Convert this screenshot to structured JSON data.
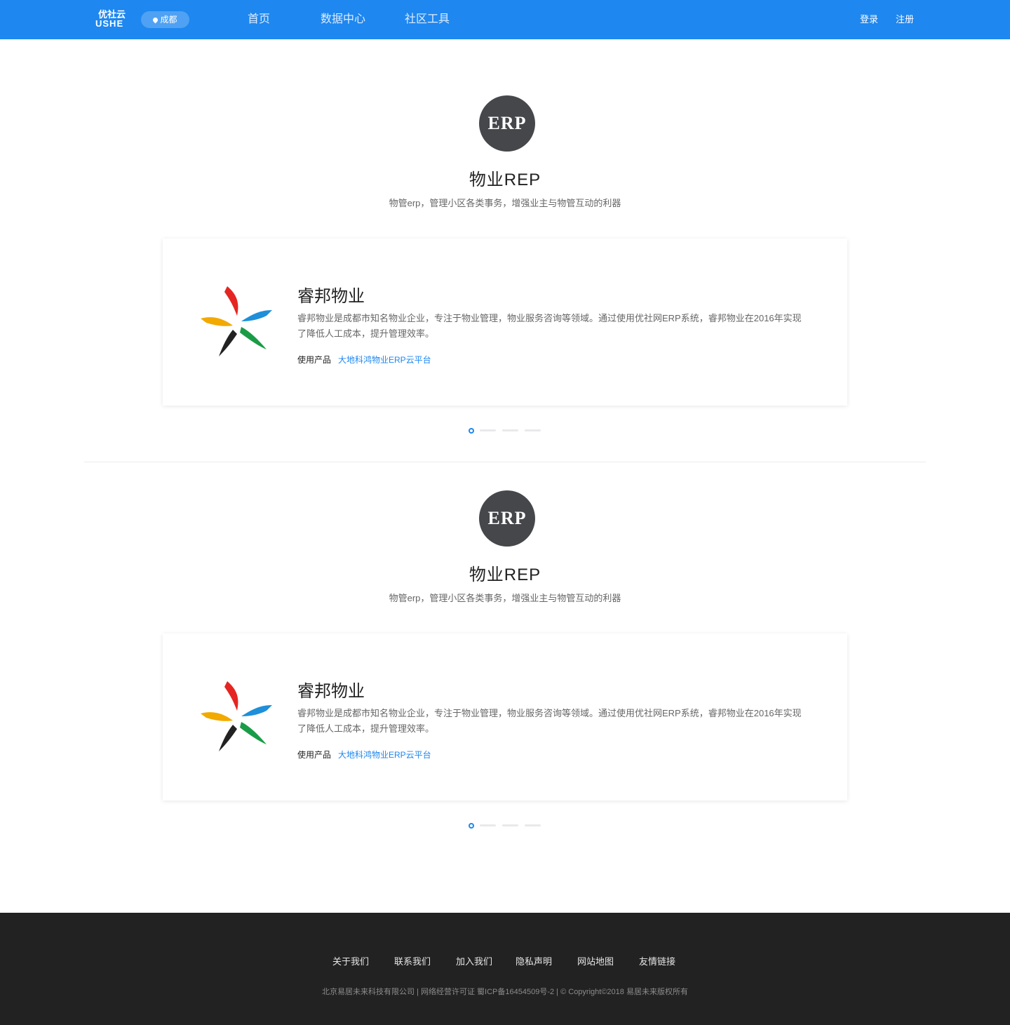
{
  "header": {
    "logo_cn": "优社云",
    "logo_en": "USHE",
    "city": "成都",
    "nav": [
      "首页",
      "数据中心",
      "社区工具"
    ],
    "login": "登录",
    "register": "注册"
  },
  "sections": [
    {
      "badge": "ERP",
      "title": "物业REP",
      "subtitle": "物管erp，管理小区各类事务，增强业主与物管互动的利器",
      "card": {
        "name": "睿邦物业",
        "desc": "睿邦物业是成都市知名物业企业，专注于物业管理，物业服务咨询等领域。通过使用优社网ERP系统，睿邦物业在2016年实现了降低人工成本，提升管理效率。",
        "product_label": "使用产品",
        "product_link": "大地科鸿物业ERP云平台"
      }
    },
    {
      "badge": "ERP",
      "title": "物业REP",
      "subtitle": "物管erp，管理小区各类事务，增强业主与物管互动的利器",
      "card": {
        "name": "睿邦物业",
        "desc": "睿邦物业是成都市知名物业企业，专注于物业管理，物业服务咨询等领域。通过使用优社网ERP系统，睿邦物业在2016年实现了降低人工成本，提升管理效率。",
        "product_label": "使用产品",
        "product_link": "大地科鸿物业ERP云平台"
      }
    }
  ],
  "footer": {
    "links": [
      "关于我们",
      "联系我们",
      "加入我们",
      "隐私声明",
      "网站地图",
      "友情链接"
    ],
    "copyright": "北京易居未来科技有限公司 | 网络经营许可证 蜀ICP备16454509号-2 | © Copyright©2018 易居未来版权所有"
  },
  "colors": {
    "primary": "#1e87f0",
    "badge_bg": "#45474b",
    "footer_bg": "#222222"
  }
}
